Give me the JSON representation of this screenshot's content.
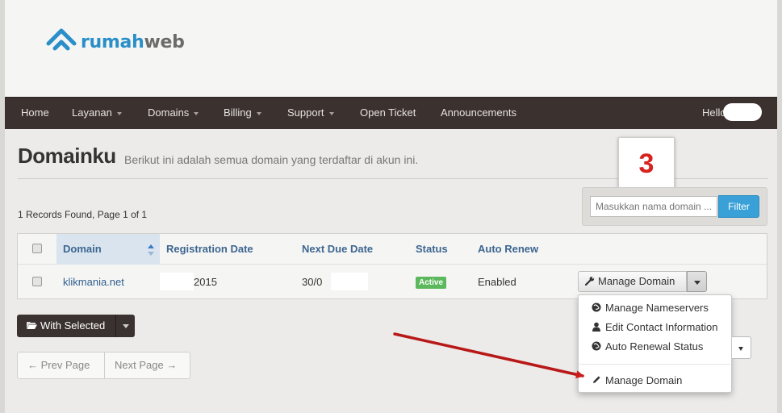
{
  "brand": {
    "logo_part1": "rumah",
    "logo_part2": "web"
  },
  "nav": {
    "items": [
      {
        "label": "Home",
        "dropdown": false
      },
      {
        "label": "Layanan",
        "dropdown": true
      },
      {
        "label": "Domains",
        "dropdown": true
      },
      {
        "label": "Billing",
        "dropdown": true
      },
      {
        "label": "Support",
        "dropdown": true
      },
      {
        "label": "Open Ticket",
        "dropdown": false
      },
      {
        "label": "Announcements",
        "dropdown": false
      }
    ],
    "user_greeting": "Hello"
  },
  "page": {
    "title": "Domainku",
    "subtitle": "Berikut ini adalah semua domain yang terdaftar di akun ini.",
    "records_info": "1 Records Found, Page 1 of 1"
  },
  "callout": {
    "number": "3"
  },
  "filter": {
    "placeholder": "Masukkan nama domain ...",
    "button_label": "Filter"
  },
  "table": {
    "headers": [
      "Domain",
      "Registration Date",
      "Next Due Date",
      "Status",
      "Auto Renew"
    ],
    "rows": [
      {
        "domain": "klikmania.net",
        "registration_date": "2015",
        "next_due_date": "30/0",
        "status": "Active",
        "auto_renew": "Enabled"
      }
    ]
  },
  "actions": {
    "manage_domain_label": "Manage Domain",
    "dropdown_items": [
      {
        "label": "Manage Nameservers",
        "icon": "globe-icon"
      },
      {
        "label": "Edit Contact Information",
        "icon": "user-icon"
      },
      {
        "label": "Auto Renewal Status",
        "icon": "globe-icon"
      },
      {
        "label": "Manage Domain",
        "icon": "pencil-icon"
      }
    ]
  },
  "bulk": {
    "with_selected_label": "With Selected"
  },
  "pager": {
    "prev_label": "← Prev Page",
    "next_label": "Next Page →"
  },
  "colors": {
    "navbar": "#3b3230",
    "accent_blue": "#3aa1d8",
    "status_green": "#5cb85c",
    "callout_red": "#d6231f",
    "arrow_red": "#cc1b1b"
  }
}
